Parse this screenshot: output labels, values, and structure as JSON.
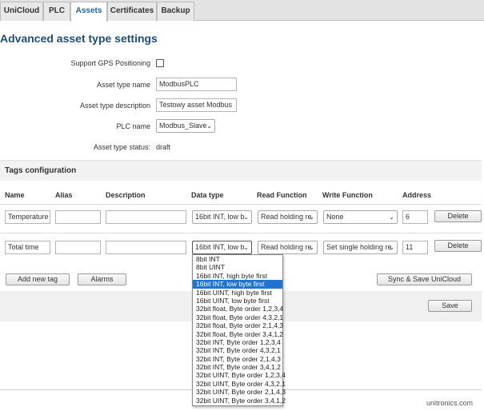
{
  "tabs": [
    {
      "label": "UniCloud",
      "active": false
    },
    {
      "label": "PLC",
      "active": false
    },
    {
      "label": "Assets",
      "active": true
    },
    {
      "label": "Certificates",
      "active": false
    },
    {
      "label": "Backup",
      "active": false
    }
  ],
  "page_title": "Advanced asset type settings",
  "settings": {
    "gps_label": "Support GPS Positioning",
    "gps_checked": false,
    "name_label": "Asset type name",
    "name_value": "ModbusPLC",
    "description_label": "Asset type description",
    "description_value": "Testowy asset Modbus",
    "plc_label": "PLC name",
    "plc_value": "Modbus_Slave",
    "status_label": "Asset type status:",
    "status_value": "draft"
  },
  "tags": {
    "section_title": "Tags configuration",
    "columns": [
      "Name",
      "Alias",
      "Description",
      "Data type",
      "Read Function",
      "Write Function",
      "Address"
    ],
    "rows": [
      {
        "name": "Temperature",
        "alias": "",
        "description": "",
        "data_type": "16bit INT, low b",
        "read_function": "Read holding re",
        "write_function": "None",
        "address": "6",
        "delete_label": "Delete"
      },
      {
        "name": "Total time",
        "alias": "",
        "description": "",
        "data_type": "16bit INT, low b",
        "read_function": "Read holding re",
        "write_function": "Set single holding re",
        "address": "11",
        "delete_label": "Delete"
      }
    ]
  },
  "buttons": {
    "add_tag": "Add new tag",
    "alarms": "Alarms",
    "sync_save": "Sync & Save UniCloud",
    "save": "Save"
  },
  "data_type_options": [
    "8bit INT",
    "8bit UINT",
    "16bit INT, high byte first",
    "16bit INT, low byte first",
    "16bit UINT, high byte first",
    "16bit UINT, low byte first",
    "32bit float, Byte order 1,2,3,4",
    "32bit float, Byte order 4,3,2,1",
    "32bit float, Byte order 2,1,4,3",
    "32bit float, Byte order 3,4,1,2",
    "32bit INT, Byte order 1,2,3,4",
    "32bit INT, Byte order 4,3,2,1",
    "32bit INT, Byte order 2,1,4,3",
    "32bit INT, Byte order 3,4,1,2",
    "32bit UINT, Byte order 1,2,3,4",
    "32bit UINT, Byte order 4,3,2,1",
    "32bit UINT, Byte order 2,1,4,3",
    "32bit UINT, Byte order 3,4,1,2"
  ],
  "selected_option_index": 3,
  "brand": "unitronics.com",
  "colors": {
    "title": "#1d4e7a",
    "active_tab": "#1a6aa0",
    "selected_option": "#1e74d0"
  }
}
